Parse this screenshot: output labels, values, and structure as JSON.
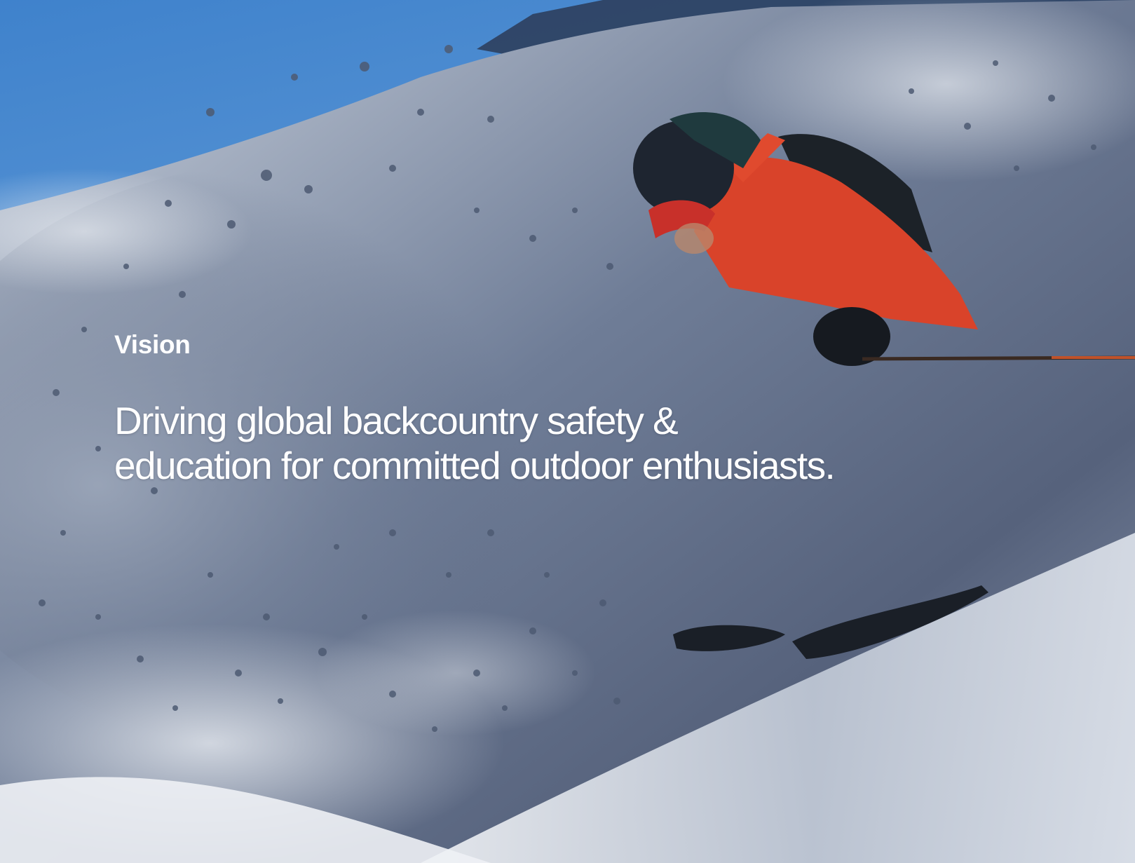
{
  "section": {
    "label": "Vision",
    "headline": "Driving global backcountry safety &\neducation for committed outdoor enthusiasts."
  },
  "background": {
    "subject": "skier carving through powder snow spray",
    "colors": {
      "sky": "#4f8fd0",
      "snow_shadow": "#5d6b85",
      "snow_light": "#e8ecf2",
      "jacket": "#d9432a",
      "helmet": "#1e2530"
    }
  }
}
